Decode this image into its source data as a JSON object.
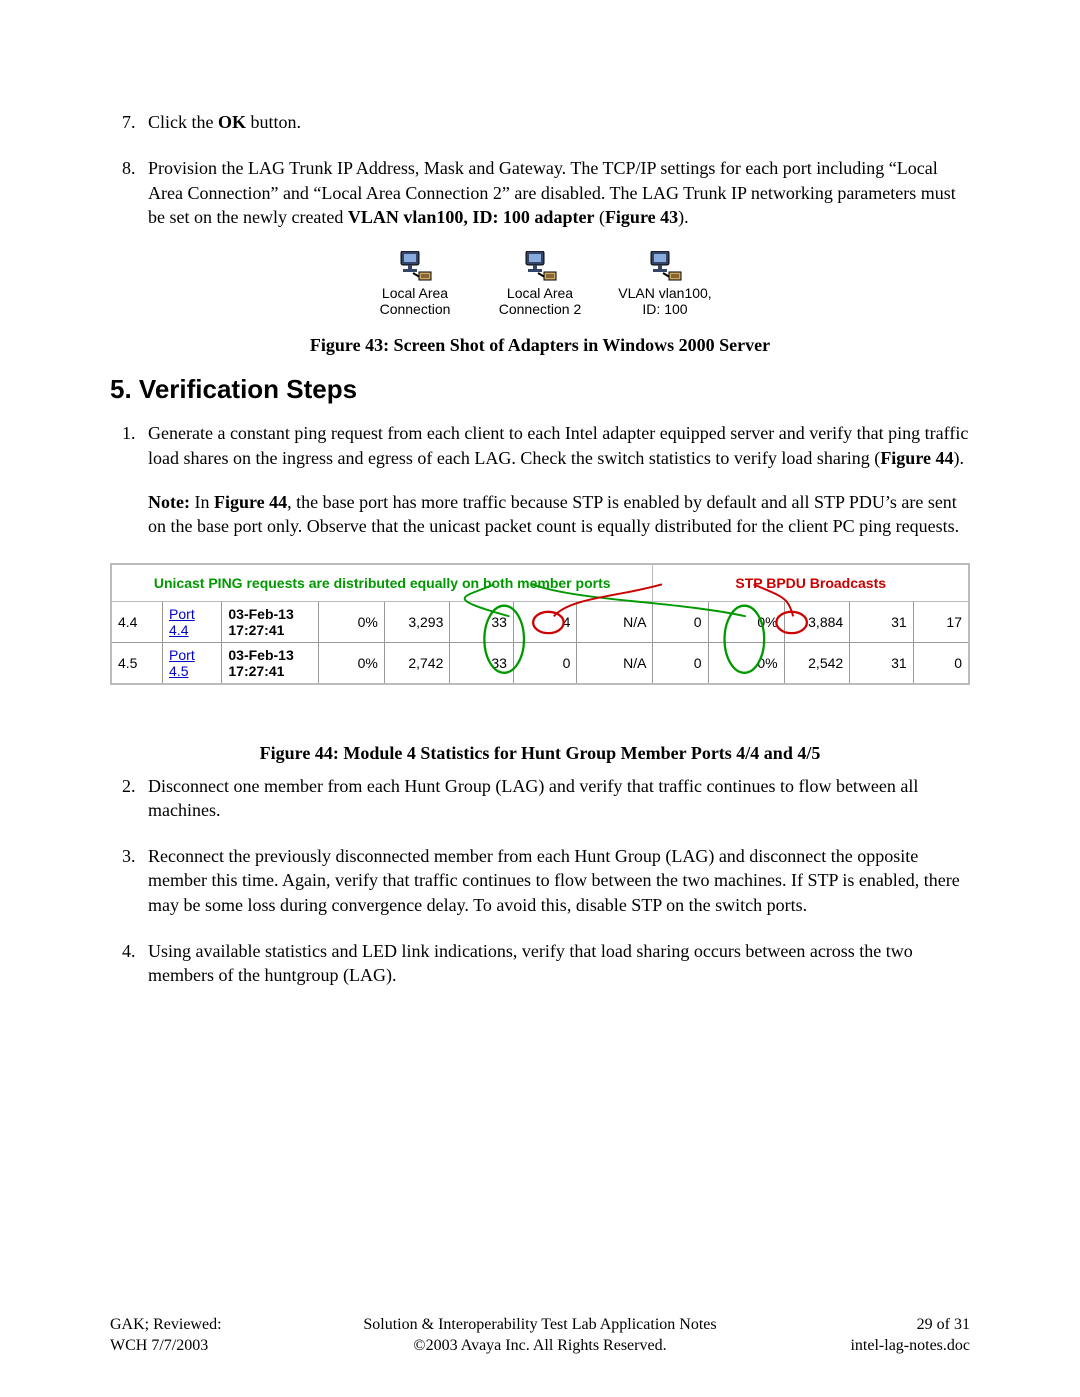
{
  "steps_a": {
    "start": 7,
    "items": [
      {
        "html": "Click the <b>OK</b> button."
      },
      {
        "html": "Provision the LAG Trunk IP Address, Mask and Gateway.  The TCP/IP settings for each port including “Local Area Connection” and “Local Area Connection 2” are disabled.  The LAG Trunk IP networking parameters must be set on the newly created <b>VLAN vlan100, ID: 100 adapter</b> (<b>Figure 43</b>)."
      }
    ]
  },
  "adapters": [
    {
      "label1": "Local Area",
      "label2": "Connection"
    },
    {
      "label1": "Local Area",
      "label2": "Connection 2"
    },
    {
      "label1": "VLAN vlan100,",
      "label2": "ID: 100"
    }
  ],
  "figure43_caption": "Figure 43: Screen Shot of Adapters in Windows 2000 Server",
  "section_heading": "5.  Verification Steps",
  "steps_b": {
    "start": 1,
    "items": [
      {
        "html": "Generate a constant ping request from each client to each Intel adapter equipped server and verify that ping traffic load shares on the ingress and egress of each LAG.  Check the switch statistics to verify load sharing (<b>Figure 44</b>).",
        "note_html": "<b>Note:</b>  In <b>Figure 44</b>, the base port has more traffic because STP is enabled by default and all STP PDU’s are sent on the base port only.  Observe that the unicast packet count is equally distributed for the client PC ping requests."
      },
      {
        "html": "Disconnect one member from each Hunt Group (LAG) and verify that traffic continues to flow between all machines."
      },
      {
        "html": "Reconnect the previously disconnected member from each Hunt Group (LAG) and disconnect the opposite member this time.  Again, verify that traffic continues to flow between the two machines.  If STP is enabled, there may be some loss during convergence delay.  To avoid this, disable STP on the switch ports."
      },
      {
        "html": "Using available statistics and LED link indications, verify that load sharing occurs between across the two members of the huntgroup (LAG)."
      }
    ]
  },
  "figure44_caption": "Figure 44: Module 4 Statistics for Hunt Group Member Ports 4/4 and 4/5",
  "stats_header_green": "Unicast PING requests are distributed equally on both member ports",
  "stats_header_red": "STP BPDU Broadcasts",
  "stats_rows": [
    {
      "col1": "4.4",
      "port_label": "Port",
      "port_num": "4.4",
      "date": "03-Feb-13",
      "time": "17:27:41",
      "pct": "0%",
      "c1": "3,293",
      "c2": "33",
      "c3": "4",
      "na": "N/A",
      "c4": "0",
      "pct2": "0%",
      "c5": "3,884",
      "c6": "31",
      "c7": "17"
    },
    {
      "col1": "4.5",
      "port_label": "Port",
      "port_num": "4.5",
      "date": "03-Feb-13",
      "time": "17:27:41",
      "pct": "0%",
      "c1": "2,742",
      "c2": "33",
      "c3": "0",
      "na": "N/A",
      "c4": "0",
      "pct2": "0%",
      "c5": "2,542",
      "c6": "31",
      "c7": "0"
    }
  ],
  "footer": {
    "left1": "GAK; Reviewed:",
    "left2": "WCH 7/7/2003",
    "center1": "Solution & Interoperability Test Lab Application Notes",
    "center2": "©2003 Avaya Inc. All Rights Reserved.",
    "right1": "29 of 31",
    "right2": "intel-lag-notes.doc"
  }
}
